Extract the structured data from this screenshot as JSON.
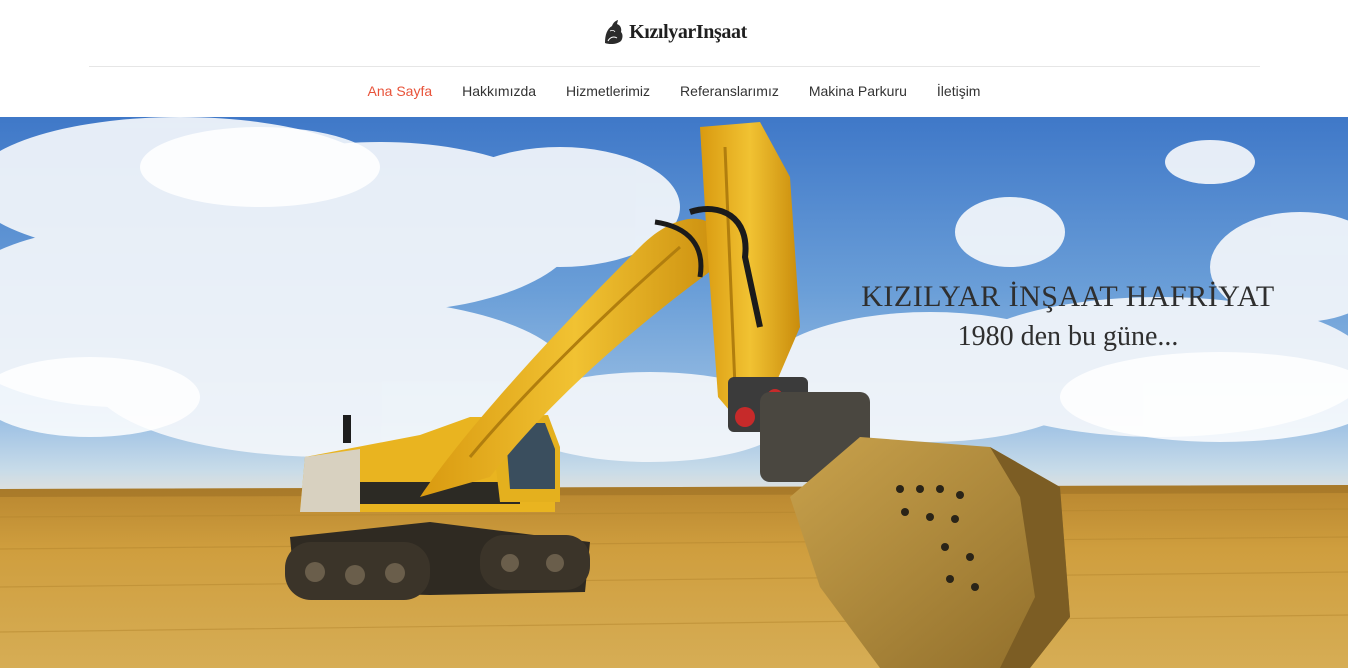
{
  "brand": {
    "name": "KızılyarInşaat",
    "logo_icon": "horse-emblem-icon"
  },
  "nav": {
    "items": [
      {
        "label": "Ana Sayfa",
        "active": true
      },
      {
        "label": "Hakkımızda",
        "active": false
      },
      {
        "label": "Hizmetlerimiz",
        "active": false
      },
      {
        "label": "Referanslarımız",
        "active": false
      },
      {
        "label": "Makina Parkuru",
        "active": false
      },
      {
        "label": "İletişim",
        "active": false
      }
    ]
  },
  "hero": {
    "title": "KIZILYAR İNŞAAT HAFRİYAT",
    "subtitle": "1980 den bu güne...",
    "image": "excavator-in-field"
  },
  "colors": {
    "accent": "#e8533a",
    "nav_text": "#333333",
    "excavator": "#e7b31c",
    "field": "#c99a3b"
  }
}
